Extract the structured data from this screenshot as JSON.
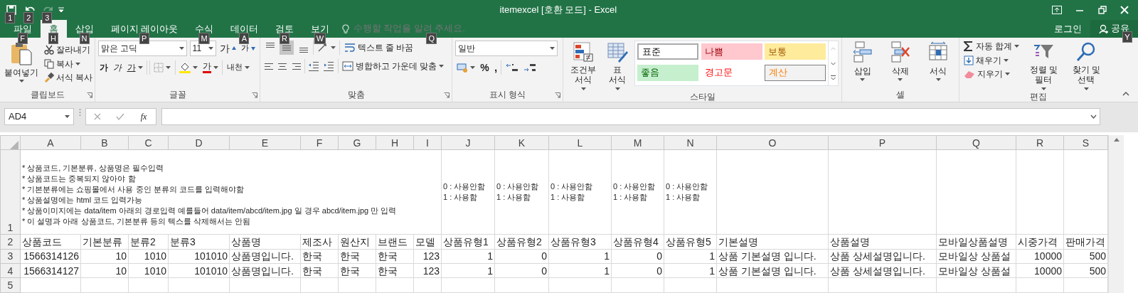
{
  "window": {
    "title": "itemexcel  [호환 모드] - Excel"
  },
  "quick_access": [
    {
      "keytip": "1",
      "disabled": false
    },
    {
      "keytip": "2",
      "disabled": false
    },
    {
      "keytip": "3",
      "disabled": true
    }
  ],
  "tabs": [
    {
      "label": "파일",
      "keytip": "F",
      "selected": false
    },
    {
      "label": "홈",
      "keytip": "H",
      "selected": true
    },
    {
      "label": "삽입",
      "keytip": "N",
      "selected": false
    },
    {
      "label": "페이지 레이아웃",
      "keytip": "P",
      "selected": false
    },
    {
      "label": "수식",
      "keytip": "M",
      "selected": false
    },
    {
      "label": "데이터",
      "keytip": "A",
      "selected": false
    },
    {
      "label": "검토",
      "keytip": "R",
      "selected": false
    },
    {
      "label": "보기",
      "keytip": "W",
      "selected": false
    }
  ],
  "tell_me": {
    "placeholder": "수행할 작업을 알려 주세요.",
    "keytip": "Q"
  },
  "account": {
    "sign_in": "로그인",
    "share": "공유",
    "share_keytip": "Y"
  },
  "ribbon": {
    "clipboard": {
      "label": "클립보드",
      "paste": "붙여넣기",
      "cut": "잘라내기",
      "copy": "복사",
      "format_painter": "서식 복사"
    },
    "font": {
      "label": "글꼴",
      "font_name": "맑은 고딕",
      "font_size": "11",
      "grow": "가",
      "shrink": "가",
      "bold": "가",
      "italic": "가",
      "underline": "가",
      "font_color": "가",
      "phonetic": "내천"
    },
    "alignment": {
      "label": "맞춤",
      "vertical": [
        {
          "selected": false
        },
        {
          "selected": true
        },
        {
          "selected": false
        }
      ],
      "wrap_text": "텍스트 줄 바꿈",
      "merge": "병합하고 가운데 맞춤"
    },
    "number": {
      "label": "표시 형식",
      "format": "일반",
      "percent": "%",
      "comma": ","
    },
    "styles": {
      "label": "스타일",
      "conditional": "조건부 서식",
      "table": "표 서식",
      "cell_styles": [
        {
          "label": "표준",
          "kind": "normal"
        },
        {
          "label": "나쁨",
          "kind": "bad"
        },
        {
          "label": "보통",
          "kind": "neutral"
        },
        {
          "label": "좋음",
          "kind": "good"
        },
        {
          "label": "경고문",
          "kind": "warning"
        },
        {
          "label": "계산",
          "kind": "calculation"
        }
      ]
    },
    "cells": {
      "label": "셀",
      "insert": "삽입",
      "delete": "삭제",
      "format": "서식"
    },
    "editing": {
      "label": "편집",
      "autosum": "자동 합계",
      "fill": "채우기",
      "clear": "지우기",
      "sort": "정렬 및 필터",
      "find": "찾기 및 선택"
    }
  },
  "formula_bar": {
    "name_box": "AD4",
    "fx": "fx"
  },
  "sheet": {
    "columns": [
      "A",
      "B",
      "C",
      "D",
      "E",
      "F",
      "G",
      "H",
      "I",
      "J",
      "K",
      "L",
      "M",
      "N",
      "O",
      "P",
      "Q",
      "R",
      "S"
    ],
    "notes_row": {
      "number": "1",
      "notes": [
        "* 상품코드, 기본분류, 상품명은 필수입력",
        "* 상품코드는 중복되지 않아야 함",
        "* 기본분류에는 쇼핑몰에서 사용 중인 분류의 코드를 입력해야함",
        "* 상품설명에는 html 코드 입력가능",
        "* 상품이미지에는 data/item 아래의 경로입력 예를들어 data/item/abcd/item.jpg 일 경우 abcd/item.jpg 만 입력",
        "* 이 설명과 아래 상품코드, 기본분류 등의 텍스를 삭제해서는 안됨"
      ],
      "flag_cells": [
        [
          "0 : 사용안함",
          "1 : 사용함"
        ],
        [
          "0 : 사용안함",
          "1 : 사용함"
        ],
        [
          "0 : 사용안함",
          "1 : 사용함"
        ],
        [
          "0 : 사용안함",
          "1 : 사용함"
        ],
        [
          "0 : 사용안함",
          "1 : 사용함"
        ]
      ]
    },
    "rows": [
      {
        "number": "2",
        "cells": [
          {
            "text": "상품코드",
            "kind": "text"
          },
          {
            "text": "기본분류",
            "kind": "text"
          },
          {
            "text": "분류2",
            "kind": "text"
          },
          {
            "text": "분류3",
            "kind": "text"
          },
          {
            "text": "상품명",
            "kind": "text"
          },
          {
            "text": "제조사",
            "kind": "text"
          },
          {
            "text": "원산지",
            "kind": "text"
          },
          {
            "text": "브랜드",
            "kind": "text"
          },
          {
            "text": "모델",
            "kind": "text"
          },
          {
            "text": "상품유형1",
            "kind": "text"
          },
          {
            "text": "상품유형2",
            "kind": "text"
          },
          {
            "text": "상품유형3",
            "kind": "text"
          },
          {
            "text": "상품유형4",
            "kind": "text"
          },
          {
            "text": "상품유형5",
            "kind": "text"
          },
          {
            "text": "기본설명",
            "kind": "text"
          },
          {
            "text": "상품설명",
            "kind": "text"
          },
          {
            "text": "모바일상품설명",
            "kind": "text"
          },
          {
            "text": "시중가격",
            "kind": "text"
          },
          {
            "text": "판매가격",
            "kind": "text"
          }
        ]
      },
      {
        "number": "3",
        "cells": [
          {
            "text": "1566314126",
            "kind": "number"
          },
          {
            "text": "10",
            "kind": "number"
          },
          {
            "text": "1010",
            "kind": "number"
          },
          {
            "text": "101010",
            "kind": "number"
          },
          {
            "text": "상품명입니다.",
            "kind": "text"
          },
          {
            "text": "한국",
            "kind": "text"
          },
          {
            "text": "한국",
            "kind": "text"
          },
          {
            "text": "한국",
            "kind": "text"
          },
          {
            "text": "123",
            "kind": "number"
          },
          {
            "text": "1",
            "kind": "number"
          },
          {
            "text": "0",
            "kind": "number"
          },
          {
            "text": "1",
            "kind": "number"
          },
          {
            "text": "0",
            "kind": "number"
          },
          {
            "text": "1",
            "kind": "number"
          },
          {
            "text": "상품 기본설명 입니다.",
            "kind": "text"
          },
          {
            "text": "상품 상세설명입니다.",
            "kind": "text"
          },
          {
            "text": "모바일상 상품설",
            "kind": "text"
          },
          {
            "text": "10000",
            "kind": "number"
          },
          {
            "text": "500",
            "kind": "number"
          }
        ]
      },
      {
        "number": "4",
        "cells": [
          {
            "text": "1566314127",
            "kind": "number"
          },
          {
            "text": "10",
            "kind": "number"
          },
          {
            "text": "1010",
            "kind": "number"
          },
          {
            "text": "101010",
            "kind": "number"
          },
          {
            "text": "상품명입니다.",
            "kind": "text"
          },
          {
            "text": "한국",
            "kind": "text"
          },
          {
            "text": "한국",
            "kind": "text"
          },
          {
            "text": "한국",
            "kind": "text"
          },
          {
            "text": "123",
            "kind": "number"
          },
          {
            "text": "1",
            "kind": "number"
          },
          {
            "text": "0",
            "kind": "number"
          },
          {
            "text": "1",
            "kind": "number"
          },
          {
            "text": "0",
            "kind": "number"
          },
          {
            "text": "1",
            "kind": "number"
          },
          {
            "text": "상품 기본설명 입니다.",
            "kind": "text"
          },
          {
            "text": "상품 상세설명입니다.",
            "kind": "text"
          },
          {
            "text": "모바일상 상품설",
            "kind": "text"
          },
          {
            "text": "10000",
            "kind": "number"
          },
          {
            "text": "500",
            "kind": "number"
          }
        ]
      },
      {
        "number": "5"
      }
    ]
  }
}
